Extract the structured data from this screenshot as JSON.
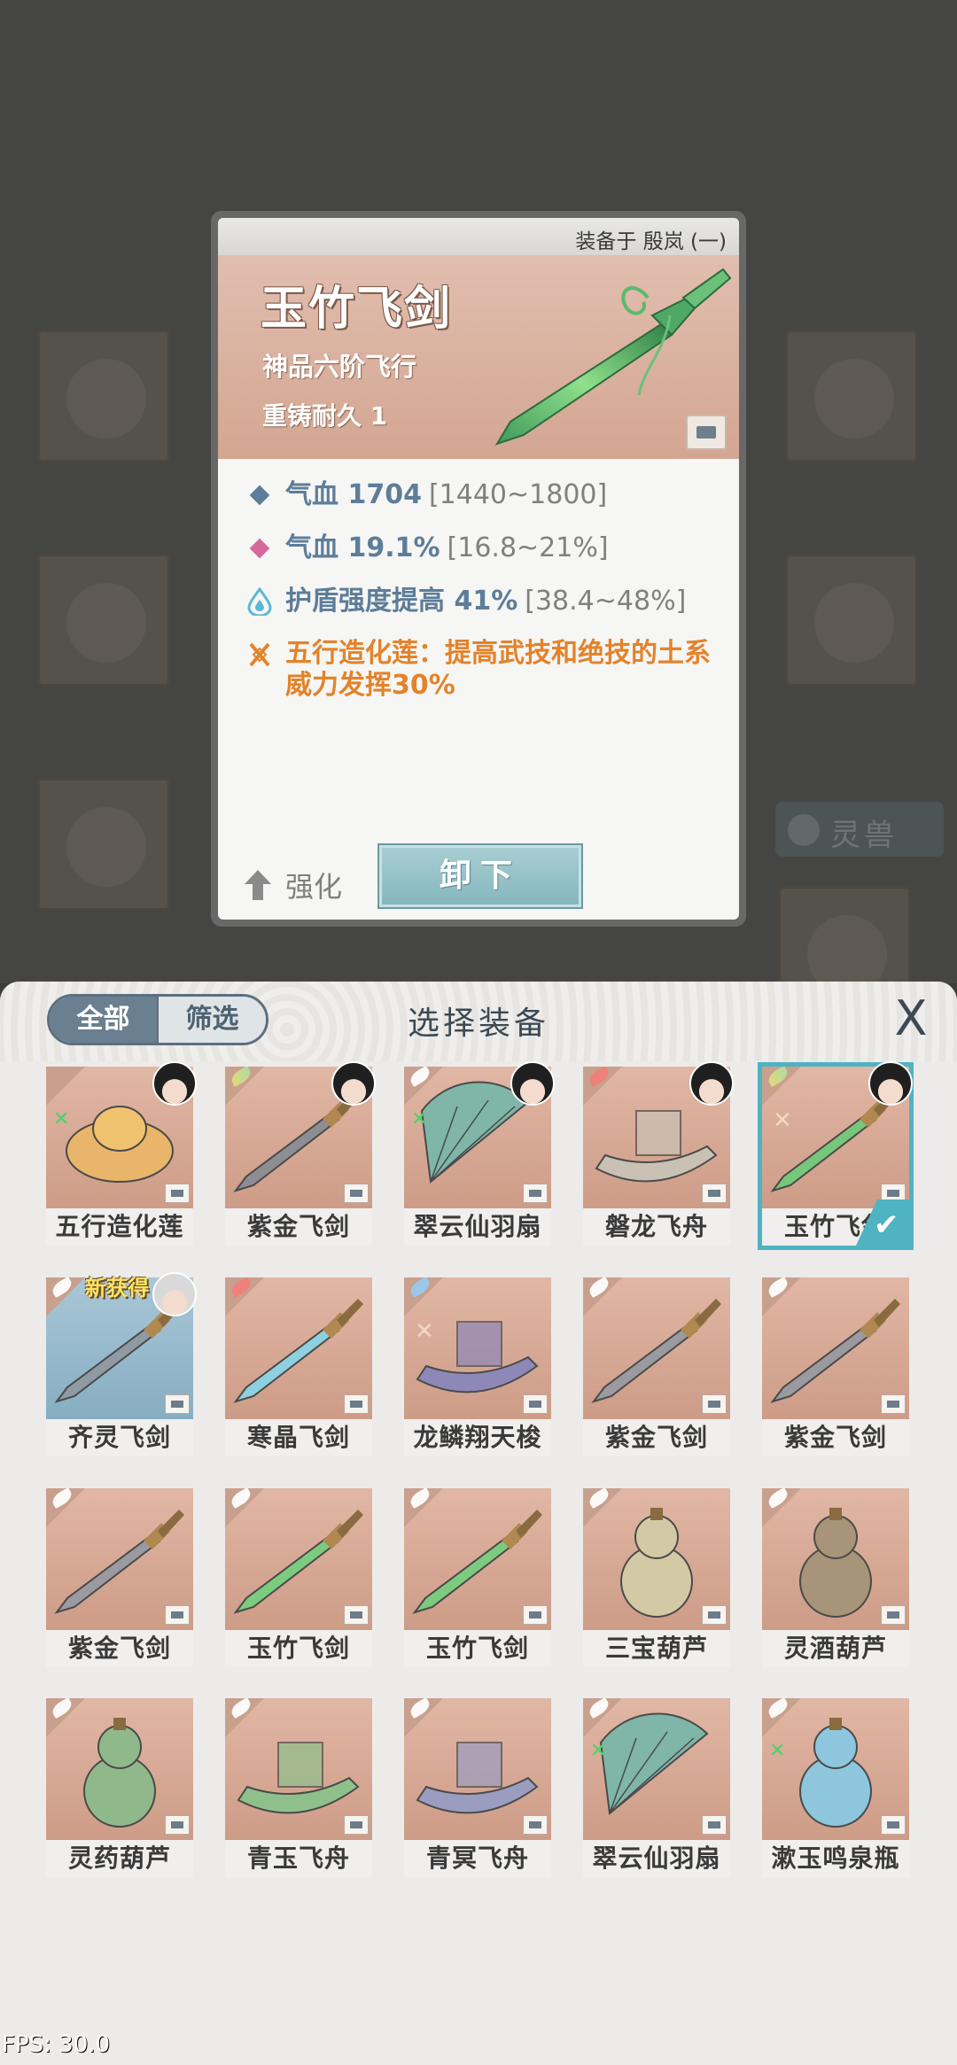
{
  "detail": {
    "equipped_on": "装备于 殷岚 (一)",
    "name": "玉竹飞剑",
    "rank": "神品六阶飞行",
    "durability": "重铸耐久 1",
    "stats": [
      {
        "main": "气血 1704",
        "range": "[1440~1800]",
        "icon": "blue-diamond-icon",
        "color": "#5d7d9a"
      },
      {
        "main": "气血 19.1%",
        "range": "[16.8~21%]",
        "icon": "pink-diamond-icon",
        "color": "#d56a9a"
      },
      {
        "main": "护盾强度提高 41%",
        "range": "[38.4~48%]",
        "icon": "water-drop-icon",
        "color": "#5bb8d6"
      }
    ],
    "special": "五行造化莲：提高武技和绝技的土系威力发挥30%",
    "enhance_label": "强化",
    "unequip_label": "卸下"
  },
  "background": {
    "tab_label": "灵兽"
  },
  "panel": {
    "filter_all": "全部",
    "filter_screen": "筛选",
    "title": "选择装备",
    "close": "X"
  },
  "items": [
    {
      "name": "五行造化莲",
      "wing": "none",
      "avatar": true,
      "mark": "green"
    },
    {
      "name": "紫金飞剑",
      "wing": "yellow",
      "avatar": true
    },
    {
      "name": "翠云仙羽扇",
      "wing": "white",
      "avatar": true,
      "mark": "green"
    },
    {
      "name": "磐龙飞舟",
      "wing": "red",
      "avatar": true
    },
    {
      "name": "玉竹飞剑",
      "wing": "yellow",
      "avatar": true,
      "selected": true,
      "mark": "x"
    },
    {
      "name": "齐灵飞剑",
      "wing": "white",
      "avatar": true,
      "avatar_white": true,
      "new": "新获得",
      "blue": true
    },
    {
      "name": "寒晶飞剑",
      "wing": "red"
    },
    {
      "name": "龙鳞翔天梭",
      "wing": "blue",
      "mark": "x"
    },
    {
      "name": "紫金飞剑",
      "wing": "white"
    },
    {
      "name": "紫金飞剑",
      "wing": "white"
    },
    {
      "name": "紫金飞剑",
      "wing": "white"
    },
    {
      "name": "玉竹飞剑",
      "wing": "white"
    },
    {
      "name": "玉竹飞剑",
      "wing": "white"
    },
    {
      "name": "三宝葫芦",
      "wing": "white"
    },
    {
      "name": "灵酒葫芦",
      "wing": "white"
    },
    {
      "name": "灵药葫芦",
      "wing": "white"
    },
    {
      "name": "青玉飞舟",
      "wing": "white"
    },
    {
      "name": "青冥飞舟",
      "wing": "white"
    },
    {
      "name": "翠云仙羽扇",
      "wing": "white",
      "mark": "green"
    },
    {
      "name": "漱玉鸣泉瓶",
      "wing": "white",
      "mark": "green"
    }
  ],
  "fps": "FPS: 30.0"
}
